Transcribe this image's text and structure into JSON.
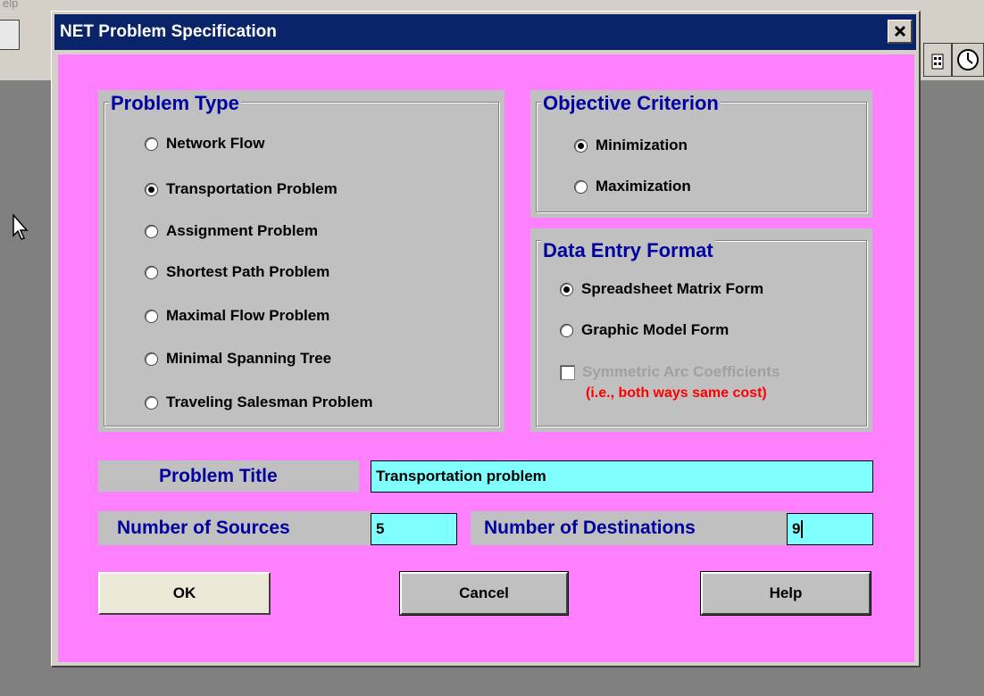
{
  "background": {
    "help_menu_fragment": "elp"
  },
  "dialog": {
    "title": "NET Problem Specification",
    "close_label": "×"
  },
  "problem_type": {
    "title": "Problem Type",
    "options": [
      {
        "label": "Network Flow",
        "selected": false
      },
      {
        "label": "Transportation Problem",
        "selected": true
      },
      {
        "label": "Assignment Problem",
        "selected": false
      },
      {
        "label": "Shortest Path Problem",
        "selected": false
      },
      {
        "label": "Maximal Flow Problem",
        "selected": false
      },
      {
        "label": "Minimal Spanning Tree",
        "selected": false
      },
      {
        "label": "Traveling Salesman Problem",
        "selected": false
      }
    ]
  },
  "objective": {
    "title": "Objective Criterion",
    "options": [
      {
        "label": "Minimization",
        "selected": true
      },
      {
        "label": "Maximization",
        "selected": false
      }
    ]
  },
  "data_entry": {
    "title": "Data Entry Format",
    "options": [
      {
        "label": "Spreadsheet Matrix Form",
        "selected": true
      },
      {
        "label": "Graphic Model Form",
        "selected": false
      }
    ],
    "symmetric_label": "Symmetric Arc Coefficients",
    "symmetric_note": "(i.e., both ways same cost)",
    "symmetric_checked": false,
    "symmetric_disabled": true
  },
  "problem_title": {
    "label": "Problem Title",
    "value": "Transportation problem"
  },
  "sources": {
    "label": "Number of Sources",
    "value": "5"
  },
  "destinations": {
    "label": "Number of Destinations",
    "value": "9"
  },
  "buttons": {
    "ok": "OK",
    "cancel": "Cancel",
    "help": "Help"
  },
  "colors": {
    "client_bg": "#ff80ff",
    "titlebar": "#0a246a",
    "group_title": "#0000a0",
    "field_bg": "#80ffff",
    "note_red": "#ff0000",
    "disabled_text": "#a0a0a0"
  }
}
